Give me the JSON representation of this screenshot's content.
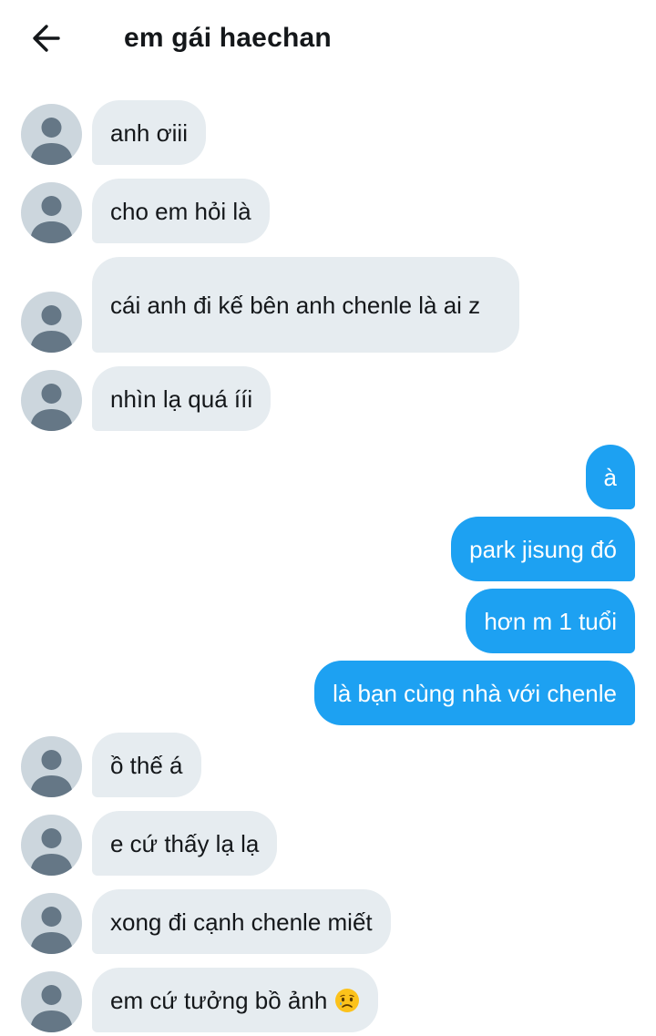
{
  "header": {
    "title": "em gái haechan",
    "back_icon": "arrow-left-icon"
  },
  "colors": {
    "incoming_bubble": "#e6ecf0",
    "outgoing_bubble": "#1da1f2",
    "avatar_placeholder": "#ccd6dd"
  },
  "messages": [
    {
      "side": "incoming",
      "text": "anh ơiii"
    },
    {
      "side": "incoming",
      "text": "cho em hỏi là"
    },
    {
      "side": "incoming",
      "text": "cái anh đi kế bên anh chenle là ai z"
    },
    {
      "side": "incoming",
      "text": "nhìn lạ quá ííi"
    },
    {
      "side": "outgoing",
      "text": "à"
    },
    {
      "side": "outgoing",
      "text": "park jisung đó"
    },
    {
      "side": "outgoing",
      "text": "hơn m 1 tuổi"
    },
    {
      "side": "outgoing",
      "text": "là bạn cùng nhà với chenle"
    },
    {
      "side": "incoming",
      "text": "ồ thế á"
    },
    {
      "side": "incoming",
      "text": "e cứ thấy lạ lạ"
    },
    {
      "side": "incoming",
      "text": "xong đi cạnh chenle miết"
    },
    {
      "side": "incoming",
      "text": "em cứ tưởng bồ ảnh",
      "emoji": "sad-face-emoji"
    }
  ]
}
